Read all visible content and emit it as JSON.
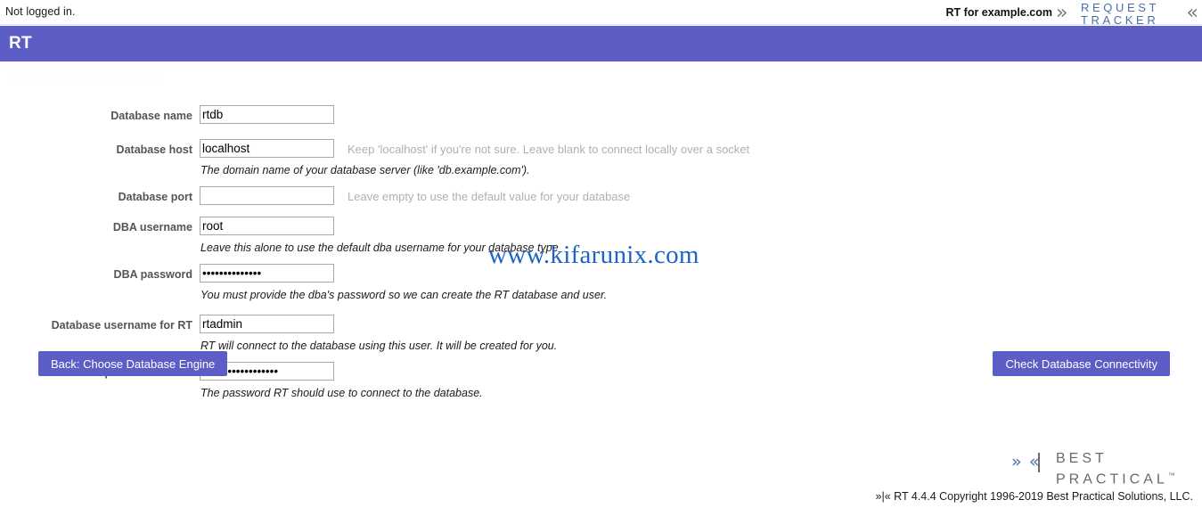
{
  "topbar": {
    "login_status": "Not logged in.",
    "instance_label": "RT for example.com",
    "logo": {
      "chevron_left": "»",
      "chevron_right": "«",
      "line1": "REQUEST",
      "line2": "TRACKER"
    }
  },
  "navbar": {
    "brand": "RT",
    "background_color": "#5d5dc6"
  },
  "page": {
    "ghost_title": "Customize Basics"
  },
  "watermark": {
    "text": "www.kifarunix.com",
    "color": "#1f63c4"
  },
  "form": {
    "fields": [
      {
        "label": "Database name",
        "value": "rtdb",
        "type": "text",
        "hint": "",
        "description": ""
      },
      {
        "label": "Database host",
        "value": "localhost",
        "type": "text",
        "hint": "Keep 'localhost' if you're not sure. Leave blank to connect locally over a socket",
        "description": "The domain name of your database server (like 'db.example.com')."
      },
      {
        "label": "Database port",
        "value": "",
        "type": "text",
        "hint": "Leave empty to use the default value for your database",
        "description": ""
      },
      {
        "label": "DBA username",
        "value": "root",
        "type": "text",
        "hint": "",
        "description": "Leave this alone to use the default dba username for your database type"
      },
      {
        "label": "DBA password",
        "value": "••••••••••••••",
        "type": "password",
        "hint": "",
        "description": "You must provide the dba's password so we can create the RT database and user."
      },
      {
        "label": "Database username for RT",
        "value": "rtadmin",
        "type": "text",
        "hint": "",
        "description": "RT will connect to the database using this user. It will be created for you."
      },
      {
        "label": "Database password for RT",
        "value": "••••••••••••••••••",
        "type": "password",
        "hint": "",
        "description": "The password RT should use to connect to the database."
      }
    ]
  },
  "buttons": {
    "back": "Back: Choose Database Engine",
    "check": "Check Database Connectivity"
  },
  "footer": {
    "logo": {
      "chevrons": "»|«",
      "line1": "BEST",
      "line2": "PRACTICAL",
      "tm": "™"
    },
    "copyright": "»|« RT 4.4.4 Copyright 1996-2019 Best Practical Solutions, LLC."
  }
}
